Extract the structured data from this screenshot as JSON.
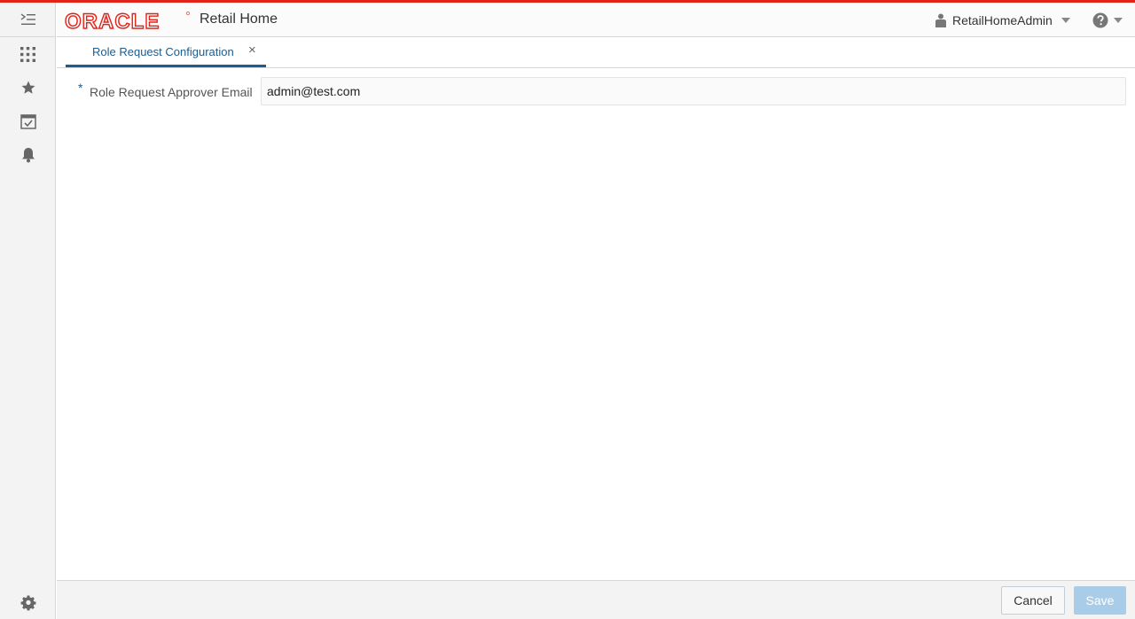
{
  "app": {
    "brand": "ORACLE",
    "title": "Retail Home"
  },
  "colors": {
    "brand_red": "#e2231a",
    "accent_blue": "#1d5c8c",
    "save_disabled": "#a9cde8"
  },
  "header": {
    "user_name": "RetailHomeAdmin",
    "user_icon": "user-icon",
    "help_icon": "help-icon"
  },
  "rail": {
    "items": [
      {
        "icon": "menu-toggle-icon"
      },
      {
        "icon": "apps-grid-icon"
      },
      {
        "icon": "favorites-star-icon"
      },
      {
        "icon": "tasks-calendar-icon"
      },
      {
        "icon": "notifications-bell-icon"
      },
      {
        "icon": "settings-gear-icon"
      }
    ]
  },
  "tabs": [
    {
      "label": "Role Request Configuration",
      "close": "×"
    }
  ],
  "form": {
    "required_marker": "*",
    "email_label": "Role Request Approver Email",
    "email_value": "admin@test.com"
  },
  "footer": {
    "cancel_label": "Cancel",
    "save_label": "Save"
  }
}
